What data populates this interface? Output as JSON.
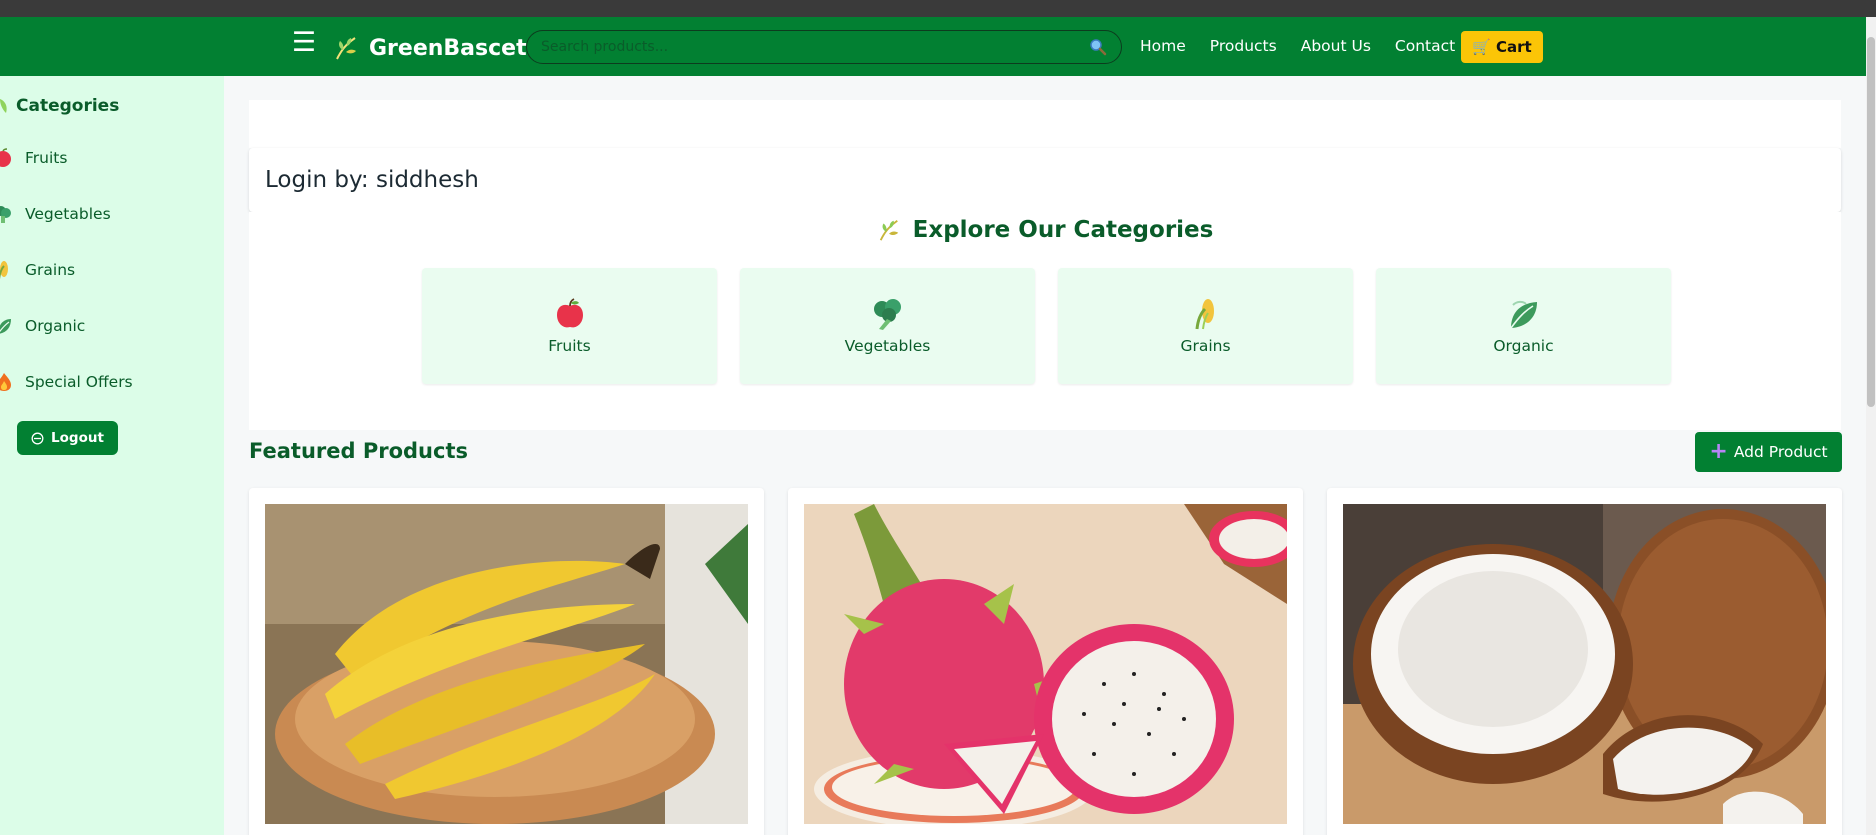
{
  "navbar": {
    "brand": "GreenBascet",
    "search_placeholder": "Search products...",
    "links": [
      "Home",
      "Products",
      "About Us",
      "Contact"
    ],
    "cart_label": "Cart",
    "colors": {
      "primary": "#028032",
      "cart": "#fbc507"
    }
  },
  "sidebar": {
    "heading": "Categories",
    "items": [
      {
        "label": "Fruits",
        "icon": "apple-icon"
      },
      {
        "label": "Vegetables",
        "icon": "broccoli-icon"
      },
      {
        "label": "Grains",
        "icon": "corn-icon"
      },
      {
        "label": "Organic",
        "icon": "leaf-icon"
      },
      {
        "label": "Special Offers",
        "icon": "fire-icon"
      }
    ],
    "logout_label": "Logout"
  },
  "main": {
    "login_text": "Login by: siddhesh",
    "explore_title": "Explore Our Categories",
    "categories": [
      {
        "label": "Fruits",
        "icon": "apple-icon"
      },
      {
        "label": "Vegetables",
        "icon": "broccoli-icon"
      },
      {
        "label": "Grains",
        "icon": "corn-icon"
      },
      {
        "label": "Organic",
        "icon": "leaf-icon"
      }
    ],
    "featured_title": "Featured Products",
    "add_product_label": "Add Product",
    "products": [
      {
        "image": "banana-image"
      },
      {
        "image": "dragon-fruit-image"
      },
      {
        "image": "coconut-image"
      }
    ]
  }
}
